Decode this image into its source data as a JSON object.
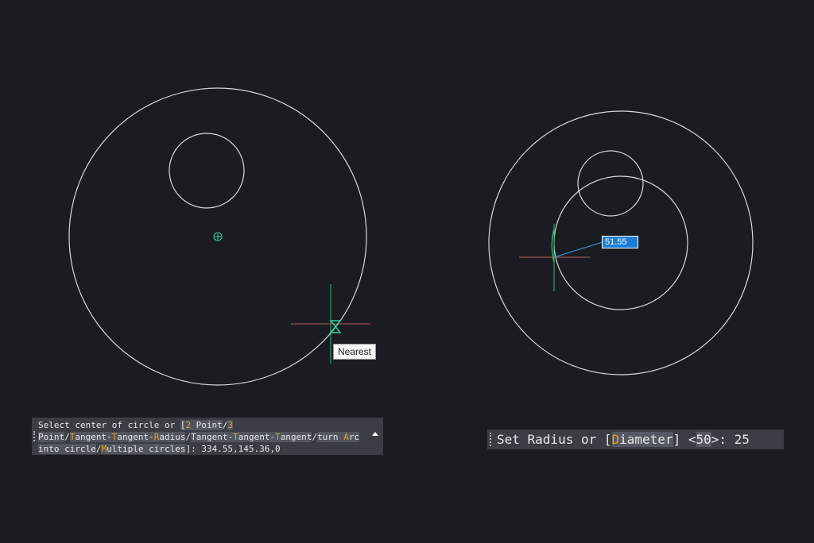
{
  "left_panel": {
    "tooltip": "Nearest",
    "command_line": {
      "l1_text": "Select center of circle or ",
      "l1_bracket": "[",
      "o1_key": "2",
      "o1_rest": " Point",
      "sep1": "/",
      "o2_key": "3",
      "o2_rest": "Point",
      "sep2": "/",
      "o3_key": "T",
      "o3_a": "angent-",
      "o3_key2": "T",
      "o3_b": "angent-",
      "o3_key3": "R",
      "o3_c": "adius",
      "sep3": "/",
      "o4_a": "Tangent-",
      "o4_key": "T",
      "o4_b": "angent-",
      "o4_key2": "T",
      "o4_c": "angent",
      "sep4": "/",
      "o5_a": "turn ",
      "o5_key": "A",
      "o5_b": "rc",
      "o5_c": "into circle",
      "sep5": "/",
      "o6_key": "M",
      "o6_rest": "ultiple circles",
      "close": "]",
      "value": ": 334.55,145.36,0"
    }
  },
  "right_panel": {
    "dynamic_input_value": "51.55",
    "command_line": {
      "prefix": "Set Radius or ",
      "open": "[",
      "opt_key": "D",
      "opt_rest": "iameter",
      "close": "]",
      "space": " ",
      "default_open": "<",
      "default_val": "50",
      "default_close": ">",
      "value": ": 25"
    }
  },
  "colors": {
    "background": "#1b1c21",
    "geometry": "#d8d8d8",
    "crosshair_x": "#b85a5a",
    "crosshair_y": "#2fb36f",
    "snap_marker": "#2fd0a0",
    "dynamic_input": "#1a7fd4",
    "option_key": "#e0a52a"
  }
}
